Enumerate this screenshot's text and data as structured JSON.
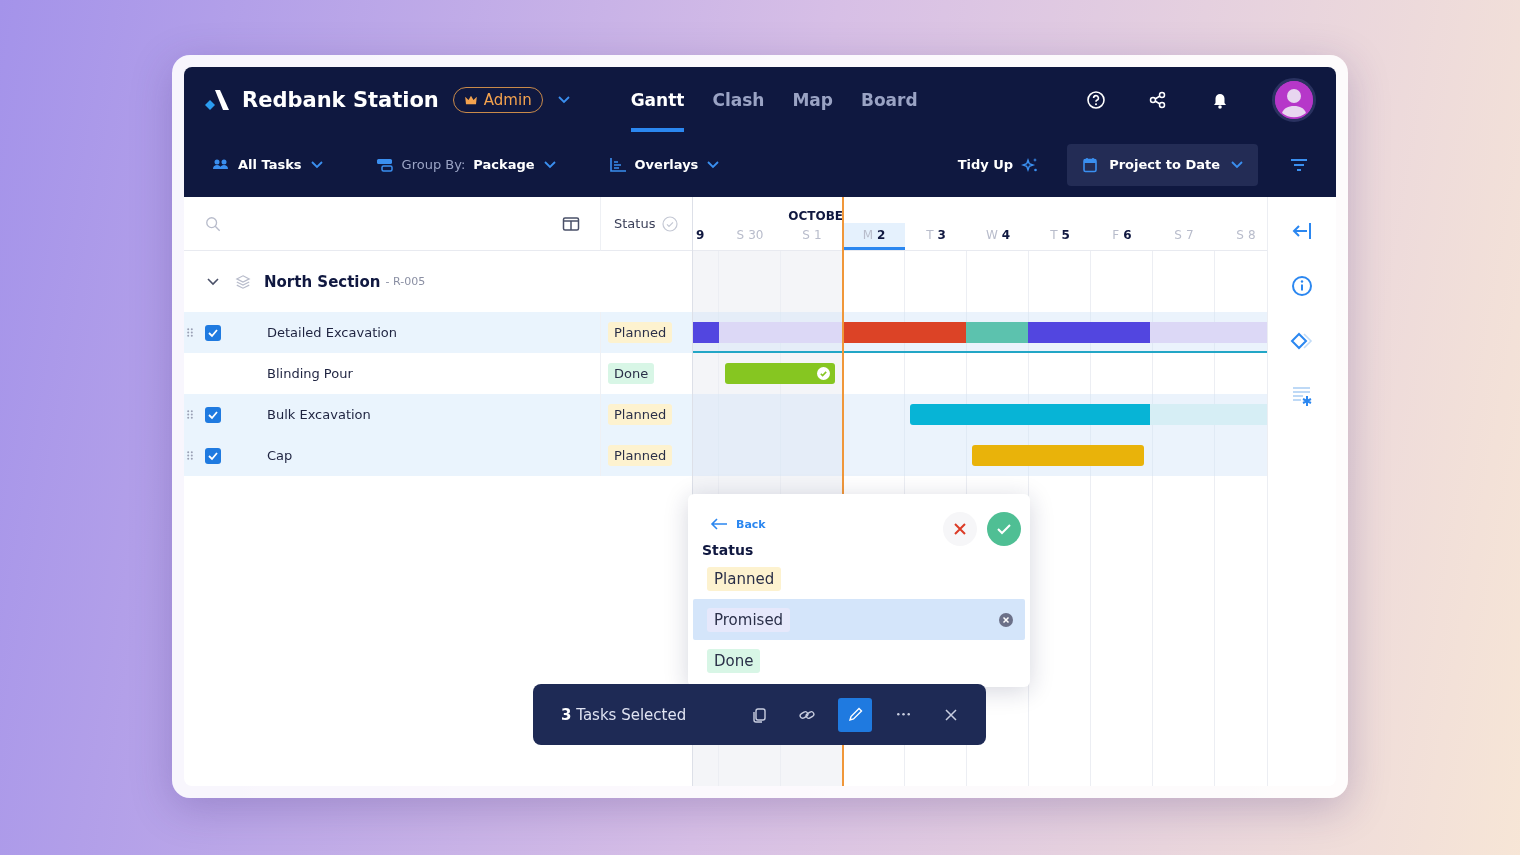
{
  "app": {
    "title": "Redbank Station",
    "role_badge": "Admin"
  },
  "tabs": [
    {
      "label": "Gantt",
      "selected": true
    },
    {
      "label": "Clash",
      "selected": false
    },
    {
      "label": "Map",
      "selected": false
    },
    {
      "label": "Board",
      "selected": false
    }
  ],
  "toolbar": {
    "filter": "All Tasks",
    "group_by_label": "Group By:",
    "group_by_value": "Package",
    "overlays": "Overlays",
    "tidy_up": "Tidy Up",
    "date_range": "Project to Date"
  },
  "table": {
    "status_column": "Status",
    "group": {
      "name": "North Section",
      "code": "- R-005",
      "expanded": true
    },
    "rows": [
      {
        "name": "Detailed Excavation",
        "status": {
          "label": "Planned",
          "color": "#fdf2cf"
        },
        "checked": true
      },
      {
        "name": "Blinding Pour",
        "status": {
          "label": "Done",
          "color": "#d8f6e6"
        },
        "checked": false
      },
      {
        "name": "Bulk Excavation",
        "status": {
          "label": "Planned",
          "color": "#fdf2cf"
        },
        "checked": true
      },
      {
        "name": "Cap",
        "status": {
          "label": "Planned",
          "color": "#fdf2cf"
        },
        "checked": true
      }
    ]
  },
  "timeline": {
    "month": "OCTOBE",
    "days": [
      {
        "num": "9",
        "weekend": false,
        "today": false
      },
      {
        "letter": "S",
        "num": "30",
        "weekend": true,
        "today": false
      },
      {
        "letter": "S",
        "num": "1",
        "weekend": true,
        "today": false
      },
      {
        "letter": "M",
        "num": "2",
        "weekend": false,
        "today": true
      },
      {
        "letter": "T",
        "num": "3",
        "weekend": false,
        "today": false
      },
      {
        "letter": "W",
        "num": "4",
        "weekend": false,
        "today": false
      },
      {
        "letter": "T",
        "num": "5",
        "weekend": false,
        "today": false
      },
      {
        "letter": "F",
        "num": "6",
        "weekend": false,
        "today": false
      },
      {
        "letter": "S",
        "num": "7",
        "weekend": true,
        "today": false
      },
      {
        "letter": "S",
        "num": "8",
        "weekend": true,
        "today": false
      }
    ],
    "bars": [
      [
        {
          "color": "#5246e0"
        },
        {
          "color": "#dcd8f6"
        },
        {
          "color": "#dc4326"
        },
        {
          "color": "#5cc2ae"
        },
        {
          "color": "#5246e0"
        },
        {
          "color": "#dcd8f6"
        }
      ],
      [
        {
          "color": "#86c621",
          "done": true
        }
      ],
      [
        {
          "color": "#07b4d6"
        },
        {
          "color": "#d6eef5"
        }
      ],
      [
        {
          "color": "#e9b30a"
        }
      ]
    ]
  },
  "status_popup": {
    "back": "Back",
    "title": "Status",
    "options": [
      {
        "label": "Planned",
        "color": "#fdf2cf",
        "selected": false
      },
      {
        "label": "Promised",
        "color": "#e6e8fb",
        "selected": true
      },
      {
        "label": "Done",
        "color": "#d8f6e6",
        "selected": false
      }
    ]
  },
  "selection_bar": {
    "text": "**3** Tasks Selected",
    "actions": [
      {
        "kind": "copy",
        "active": false
      },
      {
        "kind": "link",
        "active": false
      },
      {
        "kind": "edit",
        "active": true
      },
      {
        "kind": "more",
        "active": false
      },
      {
        "kind": "close",
        "active": false
      }
    ]
  }
}
